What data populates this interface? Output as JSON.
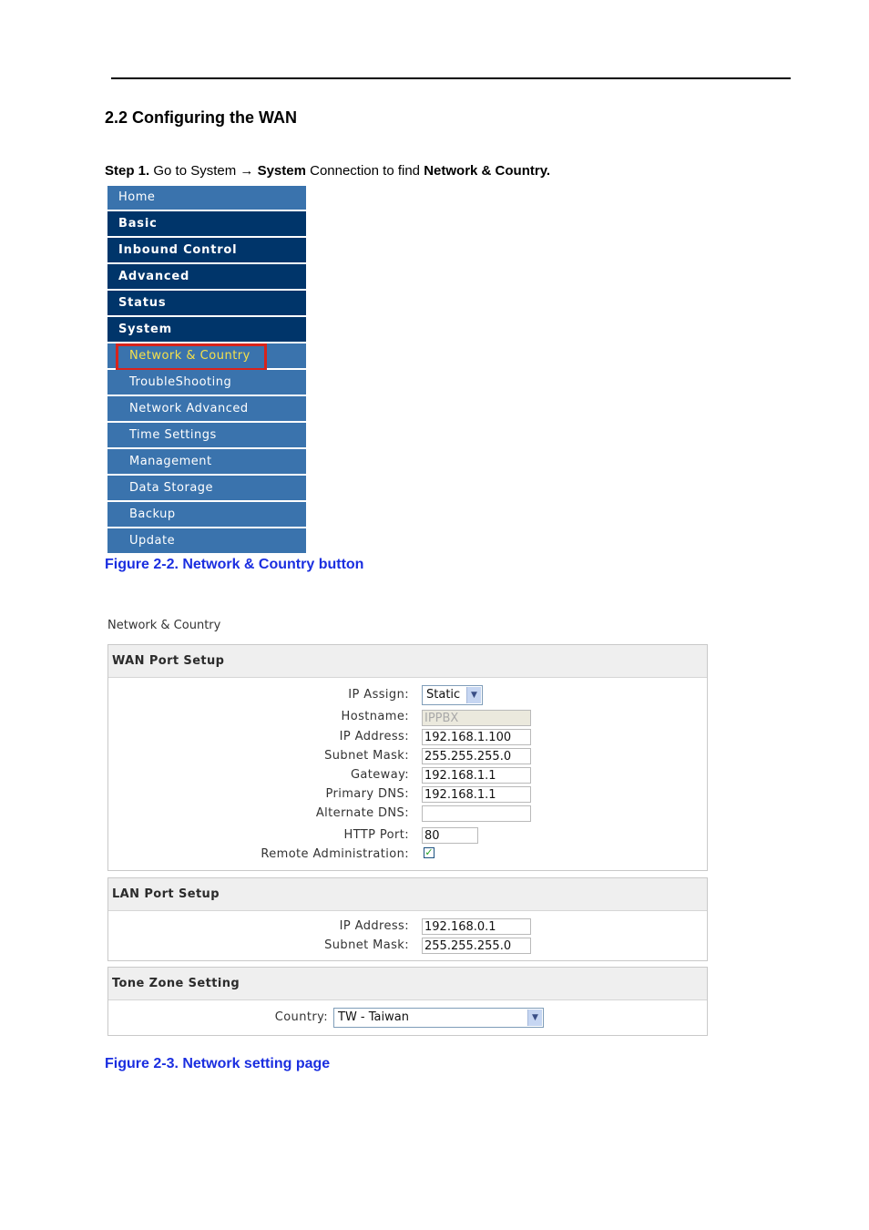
{
  "doc": {
    "heading": "2.2 Configuring the WAN",
    "step": {
      "prefix": "Step 1.",
      "t1": " Go to System → ",
      "b1": "System",
      "t2": " Connection to find ",
      "b2": "Network & Country."
    },
    "figure_1_caption": "Figure 2-2. Network & Country button",
    "figure_2_caption": "Figure 2-3. Network setting page"
  },
  "menu": {
    "home": "Home",
    "top_items": [
      "Basic",
      "Inbound Control",
      "Advanced",
      "Status",
      "System"
    ],
    "sub_items": [
      "Network & Country",
      "TroubleShooting",
      "Network Advanced",
      "Time Settings",
      "Management",
      "Data Storage",
      "Backup",
      "Update"
    ],
    "active_sub": "Network & Country",
    "colors": {
      "top": "#00356a",
      "sub": "#3a73ad",
      "active_text": "#f5e04a",
      "highlight": "#d8231b"
    }
  },
  "settings": {
    "page_title": "Network & Country",
    "wan": {
      "title": "WAN Port Setup",
      "ip_assign_label": "IP Assign:",
      "ip_assign_value": "Static",
      "hostname_label": "Hostname:",
      "hostname_value": "IPPBX",
      "ip_label": "IP Address:",
      "ip_value": "192.168.1.100",
      "mask_label": "Subnet Mask:",
      "mask_value": "255.255.255.0",
      "gateway_label": "Gateway:",
      "gateway_value": "192.168.1.1",
      "pdns_label": "Primary DNS:",
      "pdns_value": "192.168.1.1",
      "adns_label": "Alternate DNS:",
      "adns_value": "",
      "http_label": "HTTP Port:",
      "http_value": "80",
      "remote_label": "Remote Administration:",
      "remote_checked": true
    },
    "lan": {
      "title": "LAN Port Setup",
      "ip_label": "IP Address:",
      "ip_value": "192.168.0.1",
      "mask_label": "Subnet Mask:",
      "mask_value": "255.255.255.0"
    },
    "tone": {
      "title": "Tone Zone Setting",
      "country_label": "Country:",
      "country_value": "TW - Taiwan"
    }
  }
}
